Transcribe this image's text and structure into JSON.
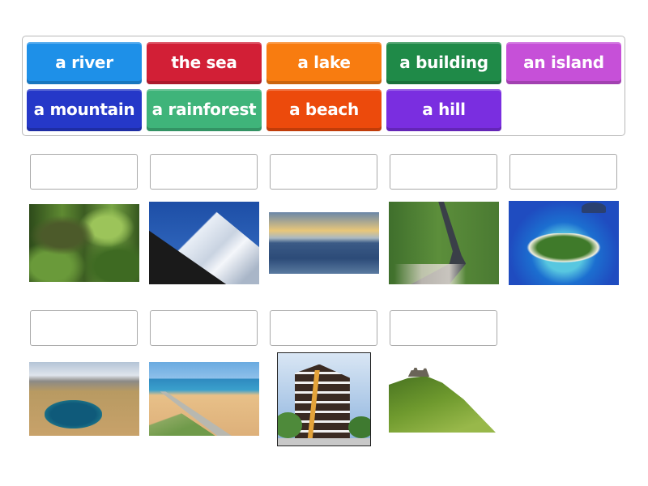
{
  "word_bank": {
    "chips": [
      {
        "label": "a river",
        "color": "#1e90e8"
      },
      {
        "label": "the sea",
        "color": "#d21f36"
      },
      {
        "label": "a lake",
        "color": "#f87c10"
      },
      {
        "label": "a building",
        "color": "#1f8a48"
      },
      {
        "label": "an island",
        "color": "#c650d8"
      },
      {
        "label": "a mountain",
        "color": "#2538c8"
      },
      {
        "label": "a rainforest",
        "color": "#3fb47a"
      },
      {
        "label": "a beach",
        "color": "#ec4a0c"
      },
      {
        "label": "a hill",
        "color": "#7a2ee0"
      }
    ]
  },
  "targets": [
    {
      "picture": "rainforest-image",
      "answer": ""
    },
    {
      "picture": "mountain-image",
      "answer": ""
    },
    {
      "picture": "sea-image",
      "answer": ""
    },
    {
      "picture": "river-image",
      "answer": ""
    },
    {
      "picture": "island-image",
      "answer": ""
    },
    {
      "picture": "lake-image",
      "answer": ""
    },
    {
      "picture": "beach-image",
      "answer": ""
    },
    {
      "picture": "building-image",
      "answer": ""
    },
    {
      "picture": "hill-image",
      "answer": ""
    }
  ]
}
